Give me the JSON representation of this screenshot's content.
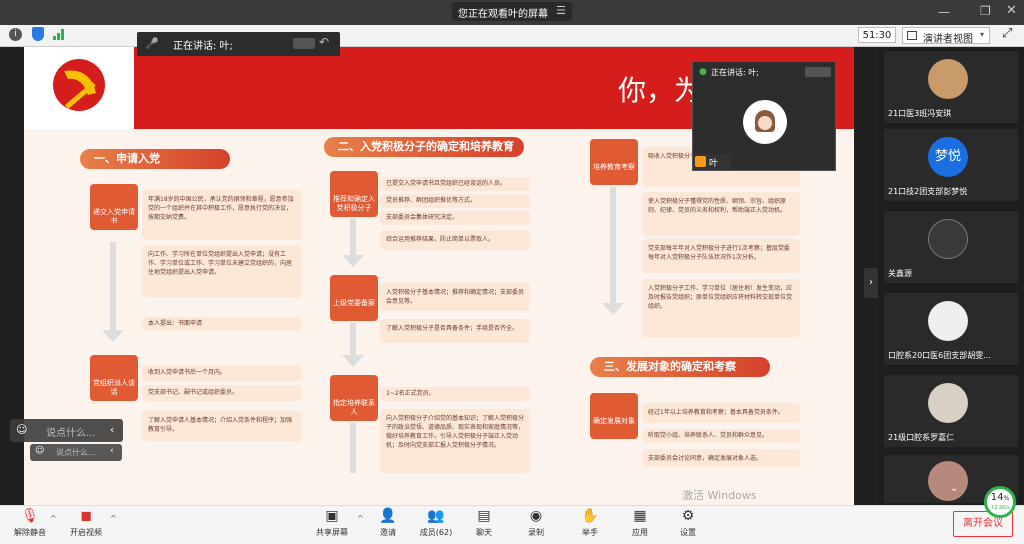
{
  "top": {
    "title": "您正在观看叶的屏幕",
    "timer": "51:30",
    "view_label": "演讲者视图"
  },
  "speaking": {
    "label": "正在讲话: 叶;"
  },
  "pip": {
    "label": "正在讲话: 叶;",
    "name": "叶"
  },
  "slide": {
    "title": "你，为",
    "watermark": "激活 Windows",
    "sec1": "一、申请入党",
    "sec2": "二、入党积极分子的确定和培养教育",
    "sec3": "三、发展对象的确定和考察",
    "step1": "递交入党申请书",
    "step2": "党组织派人谈话",
    "step3": "推荐和确定入党积极分子",
    "step4": "上级党委备案",
    "step5": "指定培养联系人",
    "step6": "培养教育考察",
    "step7": "确定发展对象",
    "b1": "年满18岁的中国公民，承认党的纲领和章程，愿意参加党的一个组织并在其中积极工作，愿意执行党的决议，按期交纳党费。",
    "b2": "向工作、学习所在单位党组织提出入党申请；没有工作、学习单位或工作、学习单位未建立党组织的，向居住地党组织提出入党申请。",
    "b2b": "本人提出：书面申请",
    "b3": "收到入党申请书后一个月内。",
    "b3b": "党支部书记、副书记或组织委员。",
    "b3c": "了解入党申请人基本情况；介绍入党条件和程序；加强教育引导。",
    "b4": "已提交入党申请书且党组织已经谈话的人员。",
    "b4b": "党员推荐、群团组织推优等方式。",
    "b4c": "支部委员会集体研究决定。",
    "b4d": "综合运用推荐结果，防止简单以票取人。",
    "b5": "入党积极分子基本情况；推荐和确定情况；支部委员会意见等。",
    "b5b": "了解入党积极分子是否具备条件；手续是否齐全。",
    "b6": "1~2名正式党员。",
    "b6b": "向入党积极分子介绍党的基本知识；了解入党积极分子的政治觉悟、道德品质、现实表现和家庭情况等，做好培养教育工作，引导入党积极分子端正入党动机；及时向党支部汇报入党积极分子情况。",
    "b7": "吸收入党积极分子参加党的一些活动。",
    "b7b": "使入党积极分子懂得党的性质、纲领、宗旨、组织原则、纪律、党员的义务和权利，帮助端正入党动机。",
    "b7c": "党支部每半年对入党积极分子进行1次考察；基层党委每年对入党积极分子队伍状况作1次分析。",
    "b7d": "入党积极分子工作、学习单位（居住地）发生变动，应及时报告党组织；原单位党组织应将材料转交现单位党组织。",
    "b8": "经过1年以上培养教育和考察；基本具备党员条件。",
    "b8b": "听取党小组、培养联系人、党员和群众意见。",
    "b8c": "支部委员会讨论同意，确定发展对象人选。"
  },
  "participants": [
    {
      "name": "21口医3班冯安琪"
    },
    {
      "name": "21口技2团支部彭梦悦",
      "initials": "梦悦"
    },
    {
      "name": "关鑫源"
    },
    {
      "name": "口腔系20口医6团支部胡雯..."
    },
    {
      "name": "21级口腔系罗嘉仁"
    },
    {
      "name": ""
    }
  ],
  "chat": {
    "placeholder": "说点什么...",
    "placeholder2": "说点什么..."
  },
  "bottom": {
    "mute": "解除静音",
    "video": "开启视频",
    "share": "共享屏幕",
    "invite": "邀请",
    "members": "成员(62)",
    "chat": "聊天",
    "record": "录制",
    "raise": "举手",
    "apps": "应用",
    "settings": "设置",
    "leave": "离开会议"
  },
  "net": {
    "percent": "14",
    "unit": "%",
    "speed": "↑2.5K/s"
  }
}
